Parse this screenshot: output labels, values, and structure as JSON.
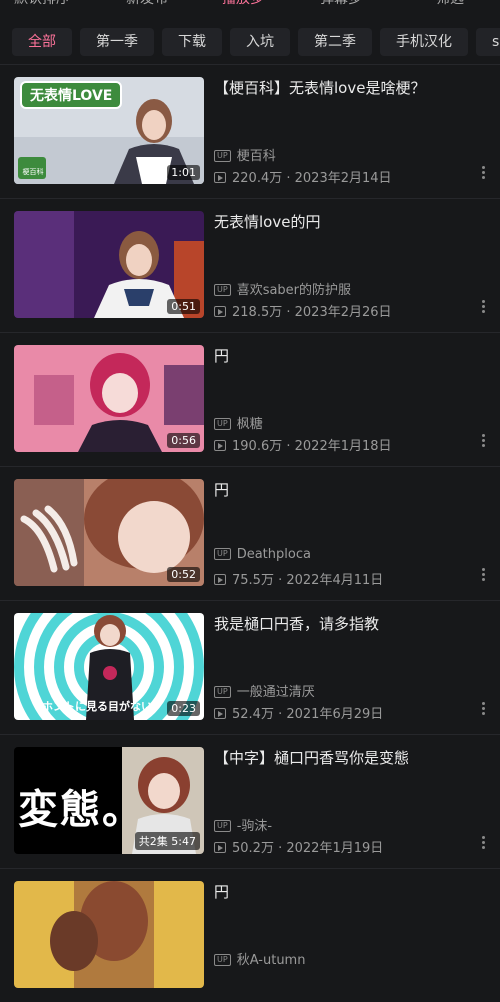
{
  "sort_tabs": [
    {
      "label": "默认排序",
      "active": false
    },
    {
      "label": "新发布",
      "active": false
    },
    {
      "label": "播放多",
      "active": true
    },
    {
      "label": "弹幕多",
      "active": false
    },
    {
      "label": "筛选",
      "active": false
    }
  ],
  "chips": [
    {
      "label": "全部",
      "active": true
    },
    {
      "label": "第一季",
      "active": false
    },
    {
      "label": "下载",
      "active": false
    },
    {
      "label": "入坑",
      "active": false
    },
    {
      "label": "第二季",
      "active": false
    },
    {
      "label": "手机汉化",
      "active": false
    },
    {
      "label": "song",
      "active": false
    }
  ],
  "up_badge": "UP",
  "videos": [
    {
      "title": "【梗百科】无表情love是啥梗？",
      "duration": "1:01",
      "uploader": "梗百科",
      "views": "220.4万",
      "date": "2023年2月14日",
      "thumb_text": "无表情LOVE",
      "thumb_badge": "梗百科"
    },
    {
      "title": "无表情love的円",
      "duration": "0:51",
      "uploader": "喜欢saber的防护服",
      "views": "218.5万",
      "date": "2023年2月26日"
    },
    {
      "title": "円",
      "duration": "0:56",
      "uploader": "枫糖",
      "views": "190.6万",
      "date": "2022年1月18日"
    },
    {
      "title": "円",
      "duration": "0:52",
      "uploader": "Deathploca",
      "views": "75.5万",
      "date": "2022年4月11日"
    },
    {
      "title": "我是樋口円香，请多指教",
      "duration": "0:23",
      "uploader": "一般通过清厌",
      "views": "52.4万",
      "date": "2021年6月29日",
      "thumb_text": "ホントに見る目がない"
    },
    {
      "title": "【中字】樋口円香骂你是变態",
      "duration": "共2集 5:47",
      "uploader": "-驹沫-",
      "views": "50.2万",
      "date": "2022年1月19日",
      "thumb_text": "変態。"
    },
    {
      "title": "円",
      "duration": "",
      "uploader": "秋A-utumn",
      "views": "",
      "date": ""
    }
  ]
}
